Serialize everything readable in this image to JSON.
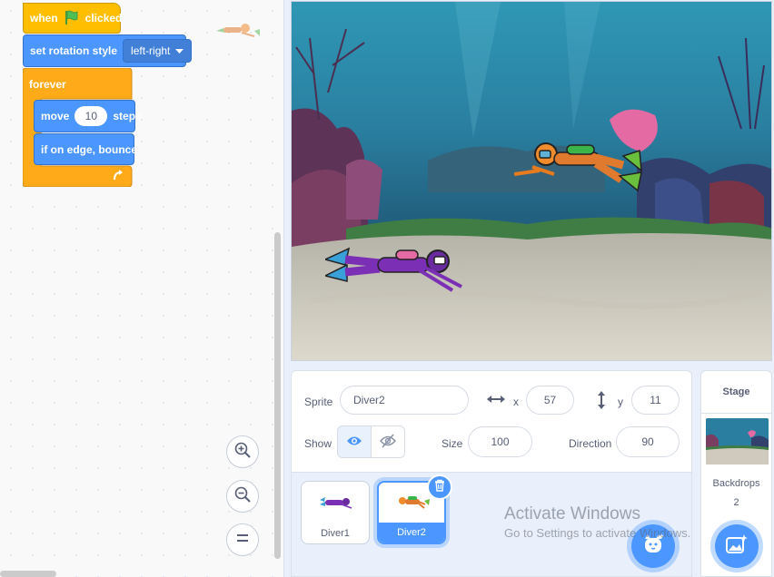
{
  "code": {
    "when_flag": {
      "when": "when",
      "clicked": "clicked"
    },
    "rotation": {
      "label": "set rotation style",
      "value": "left-right"
    },
    "forever": "forever",
    "move": {
      "label": "move",
      "value": "10",
      "unit": "steps"
    },
    "bounce": "if on edge, bounce"
  },
  "sprite_info": {
    "sprite_label": "Sprite",
    "sprite_name": "Diver2",
    "x_label": "x",
    "x_value": "57",
    "y_label": "y",
    "y_value": "11",
    "show_label": "Show",
    "size_label": "Size",
    "size_value": "100",
    "direction_label": "Direction",
    "direction_value": "90"
  },
  "sprites": [
    {
      "name": "Diver1"
    },
    {
      "name": "Diver2"
    }
  ],
  "stage_panel": {
    "title": "Stage",
    "backdrops_label": "Backdrops",
    "backdrops_count": "2"
  },
  "watermark": {
    "title": "Activate Windows",
    "subtitle": "Go to Settings to activate Windows."
  },
  "colors": {
    "events": "#ffbf00",
    "motion": "#4c97ff",
    "control": "#ffab19",
    "accent": "#4c97ff"
  }
}
